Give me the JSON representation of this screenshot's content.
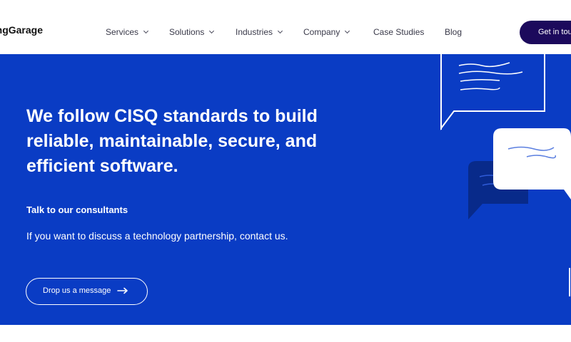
{
  "logo": {
    "text": "ngGarage"
  },
  "nav": {
    "items": [
      {
        "label": "Services",
        "has_dropdown": true
      },
      {
        "label": "Solutions",
        "has_dropdown": true
      },
      {
        "label": "Industries",
        "has_dropdown": true
      },
      {
        "label": "Company",
        "has_dropdown": true
      },
      {
        "label": "Case Studies",
        "has_dropdown": false
      },
      {
        "label": "Blog",
        "has_dropdown": false
      }
    ],
    "cta_label": "Get in touch"
  },
  "hero": {
    "headline_line1": "We follow CISQ standards to build",
    "headline_line2": "reliable, maintainable, secure, and",
    "headline_line3": "efficient software.",
    "subhead": "Talk to our consultants",
    "body": "If you want to discuss a technology partnership, contact us.",
    "button_label": "Drop us a message",
    "button_icon": "arrow-right-icon"
  },
  "colors": {
    "hero_bg": "#0a3cc4",
    "cta_bg": "#1c0a5c",
    "dark_bubble": "#082a8a",
    "text_on_blue": "#ffffff"
  }
}
